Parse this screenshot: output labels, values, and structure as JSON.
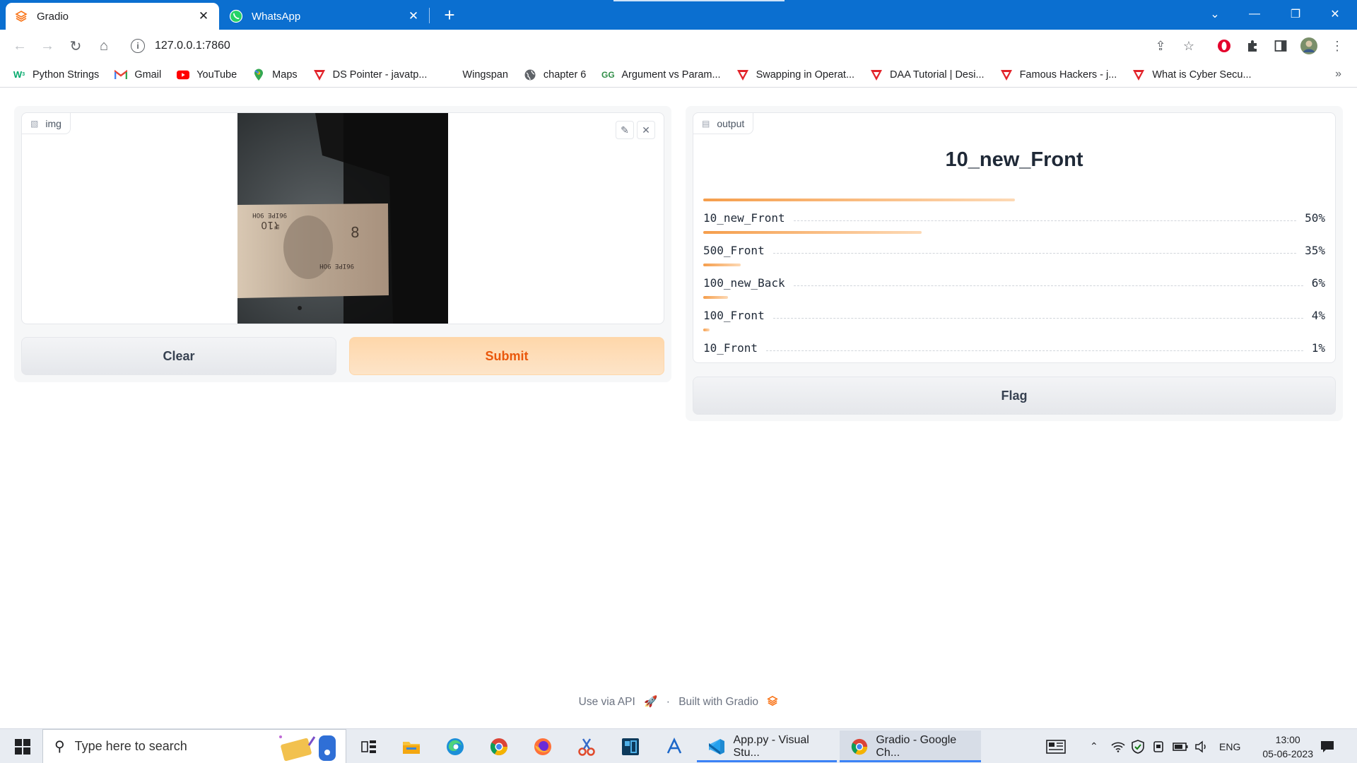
{
  "browser": {
    "tabs": [
      {
        "title": "Gradio",
        "icon": "gradio-icon"
      },
      {
        "title": "WhatsApp",
        "icon": "whatsapp-icon"
      }
    ],
    "url": "127.0.0.1:7860",
    "accent_color": "#0b6fd0"
  },
  "bookmarks": [
    {
      "label": "Python Strings",
      "icon": "w3schools-icon",
      "color": "#04aa6d"
    },
    {
      "label": "Gmail",
      "icon": "gmail-icon",
      "color": "#ea4335"
    },
    {
      "label": "YouTube",
      "icon": "youtube-icon",
      "color": "#ff0000"
    },
    {
      "label": "Maps",
      "icon": "maps-icon",
      "color": "#34a853"
    },
    {
      "label": "DS Pointer - javatp...",
      "icon": "javatpoint-icon",
      "color": "#e2232a"
    },
    {
      "label": "Wingspan",
      "icon": "blank-icon",
      "color": "#ffffff"
    },
    {
      "label": "chapter 6",
      "icon": "globe-icon",
      "color": "#5f6368"
    },
    {
      "label": "Argument vs Param...",
      "icon": "geeksforgeeks-icon",
      "color": "#2f8d46"
    },
    {
      "label": "Swapping in Operat...",
      "icon": "javatpoint-icon",
      "color": "#e2232a"
    },
    {
      "label": "DAA Tutorial | Desi...",
      "icon": "javatpoint-icon",
      "color": "#e2232a"
    },
    {
      "label": "Famous Hackers - j...",
      "icon": "javatpoint-icon",
      "color": "#e2232a"
    },
    {
      "label": "What is Cyber Secu...",
      "icon": "javatpoint-icon",
      "color": "#e2232a"
    }
  ],
  "app": {
    "input": {
      "label": "img",
      "image_description_icon": "banknote-image"
    },
    "buttons": {
      "clear": "Clear",
      "submit": "Submit",
      "flag": "Flag"
    },
    "output": {
      "label": "output",
      "top_label": "10_new_Front",
      "confidences": [
        {
          "label": "10_new_Front",
          "percent_text": "50%",
          "value": 0.5
        },
        {
          "label": "500_Front",
          "percent_text": "35%",
          "value": 0.35
        },
        {
          "label": "100_new_Back",
          "percent_text": "6%",
          "value": 0.06
        },
        {
          "label": "100_Front",
          "percent_text": "4%",
          "value": 0.04
        },
        {
          "label": "10_Front",
          "percent_text": "1%",
          "value": 0.01
        }
      ]
    },
    "footer": {
      "api": "Use via API",
      "sep": "·",
      "built": "Built with Gradio"
    }
  },
  "taskbar": {
    "search_placeholder": "Type here to search",
    "windows": [
      {
        "title": "App.py - Visual Stu...",
        "icon": "vscode-icon"
      },
      {
        "title": "Gradio - Google Ch...",
        "icon": "chrome-icon"
      }
    ],
    "language": "ENG",
    "time": "13:00",
    "date": "05-06-2023"
  }
}
